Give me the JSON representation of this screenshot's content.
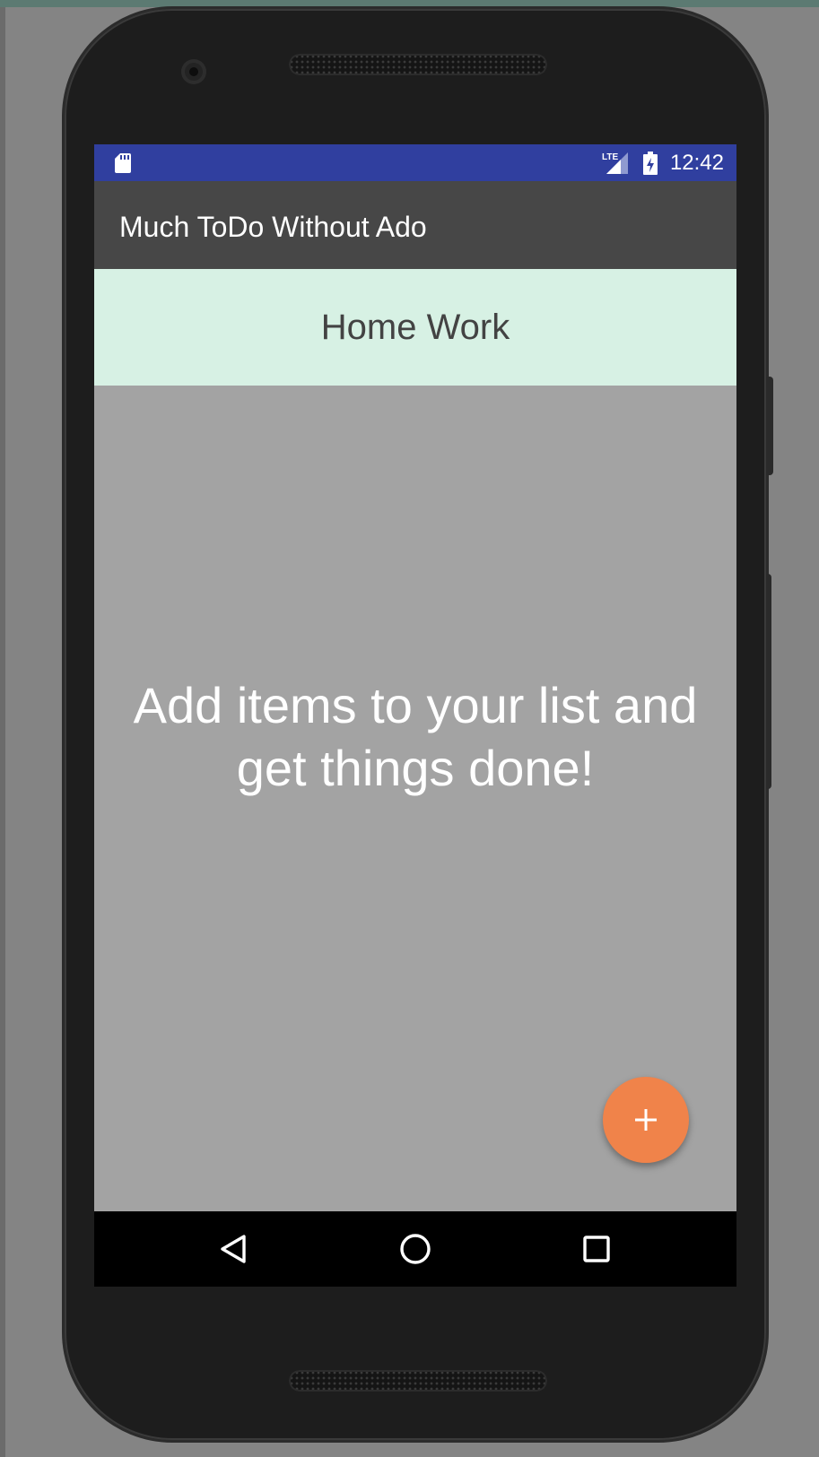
{
  "status_bar": {
    "time": "12:42",
    "network_label": "LTE",
    "icons": [
      "sd-card-icon",
      "lte-signal-icon",
      "battery-charging-icon"
    ],
    "background": "#303f9f"
  },
  "app_bar": {
    "title": "Much ToDo Without Ado",
    "background": "#474747"
  },
  "list_header": {
    "name": "Home Work",
    "background": "#d7f1e4"
  },
  "main": {
    "empty_message": "Add items to your list and get things done!"
  },
  "fab": {
    "icon": "plus-icon",
    "color": "#f0834a"
  },
  "nav_bar": {
    "buttons": [
      {
        "icon": "back-triangle-icon"
      },
      {
        "icon": "home-circle-icon"
      },
      {
        "icon": "recents-square-icon"
      }
    ]
  }
}
